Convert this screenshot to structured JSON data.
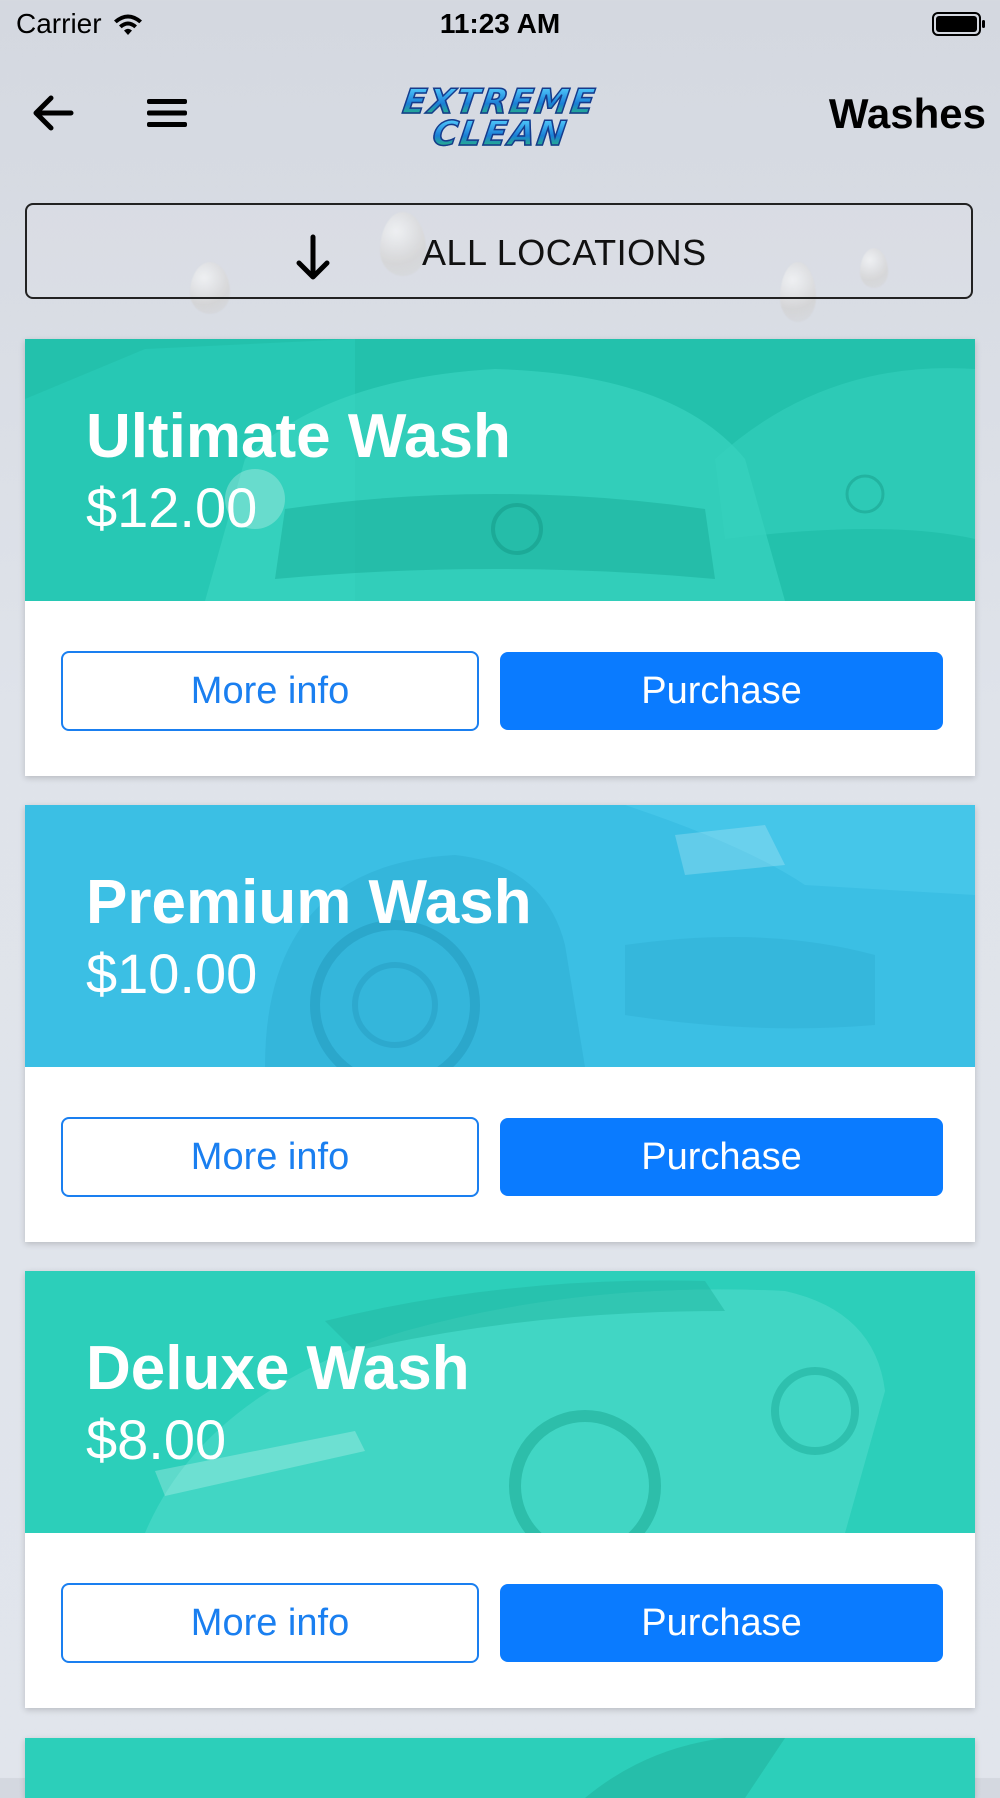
{
  "status_bar": {
    "carrier": "Carrier",
    "time": "11:23 AM",
    "icons": [
      "wifi-icon",
      "battery-icon"
    ]
  },
  "nav": {
    "back_icon": "arrow-left-icon",
    "menu_icon": "hamburger-menu-icon",
    "logo_line1": "EXTREME",
    "logo_line2": "CLEAN",
    "title": "Washes"
  },
  "location": {
    "icon": "arrow-down-icon",
    "label": "ALL LOCATIONS"
  },
  "washes": [
    {
      "name": "Ultimate Wash",
      "price": "$12.00",
      "header_color": "#2cc9b5",
      "more_info_label": "More info",
      "purchase_label": "Purchase"
    },
    {
      "name": "Premium Wash",
      "price": "$10.00",
      "header_color": "#3fc3e6",
      "more_info_label": "More info",
      "purchase_label": "Purchase"
    },
    {
      "name": "Deluxe Wash",
      "price": "$8.00",
      "header_color": "#2ed1bd",
      "more_info_label": "More info",
      "purchase_label": "Purchase"
    }
  ],
  "colors": {
    "accent": "#0a7bff",
    "text_primary": "#000000"
  }
}
